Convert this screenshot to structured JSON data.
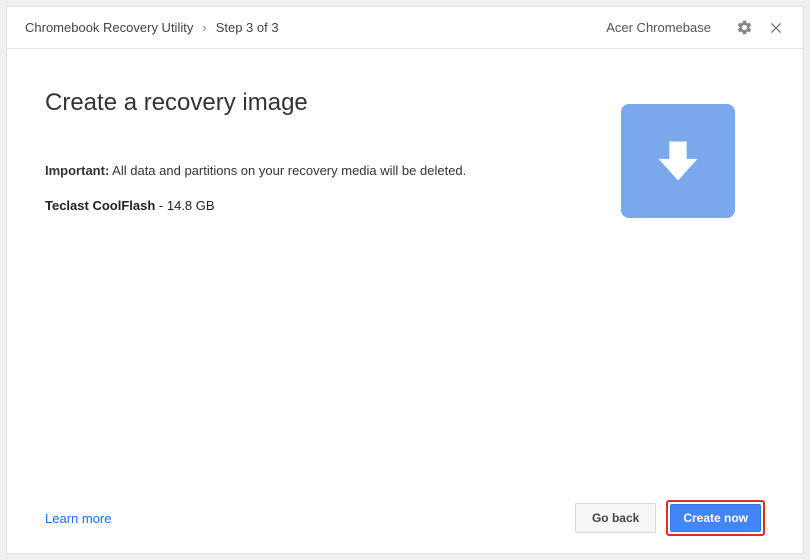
{
  "header": {
    "app_title": "Chromebook Recovery Utility",
    "separator": "›",
    "step_label": "Step 3 of 3",
    "device": "Acer Chromebase"
  },
  "content": {
    "title": "Create a recovery image",
    "important_label": "Important:",
    "warning_text": " All data and partitions on your recovery media will be deleted.",
    "media_name": "Teclast CoolFlash",
    "media_sep": " - ",
    "media_size": "14.8 GB"
  },
  "footer": {
    "learn_more": "Learn more",
    "go_back": "Go back",
    "create_now": "Create now"
  }
}
